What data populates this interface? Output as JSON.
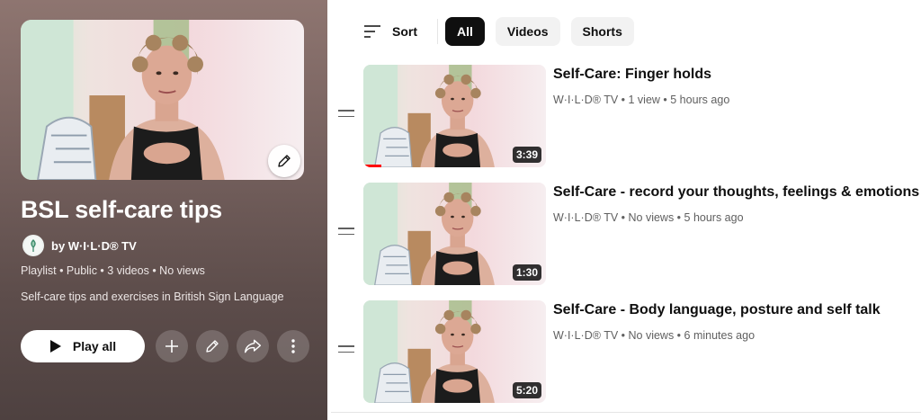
{
  "playlist": {
    "title": "BSL self-care tips",
    "owner": "by W·I·L·D® TV",
    "meta": "Playlist • Public • 3 videos • No views",
    "description": "Self-care tips and exercises in British Sign Language",
    "play_all_label": "Play all",
    "icons": [
      "pencil-icon",
      "play-icon",
      "plus-icon",
      "pencil-icon",
      "share-icon",
      "more-vert-icon"
    ]
  },
  "filters": {
    "sort_label": "Sort",
    "chips": [
      {
        "label": "All",
        "active": true
      },
      {
        "label": "Videos",
        "active": false
      },
      {
        "label": "Shorts",
        "active": false
      }
    ]
  },
  "videos": [
    {
      "title": "Self-Care: Finger holds",
      "meta": "W·I·L·D® TV • 1 view • 5 hours ago",
      "duration": "3:39",
      "watched_fraction": 0.1
    },
    {
      "title": "Self-Care - record your thoughts, feelings & emotions",
      "meta": "W·I·L·D® TV • No views • 5 hours ago",
      "duration": "1:30",
      "watched_fraction": 0
    },
    {
      "title": "Self-Care - Body language, posture and self talk",
      "meta": "W·I·L·D® TV • No views • 6 minutes ago",
      "duration": "5:20",
      "watched_fraction": 0
    }
  ],
  "colors": {
    "progress": "#ff0000",
    "active_chip": "#0f0f0f"
  }
}
